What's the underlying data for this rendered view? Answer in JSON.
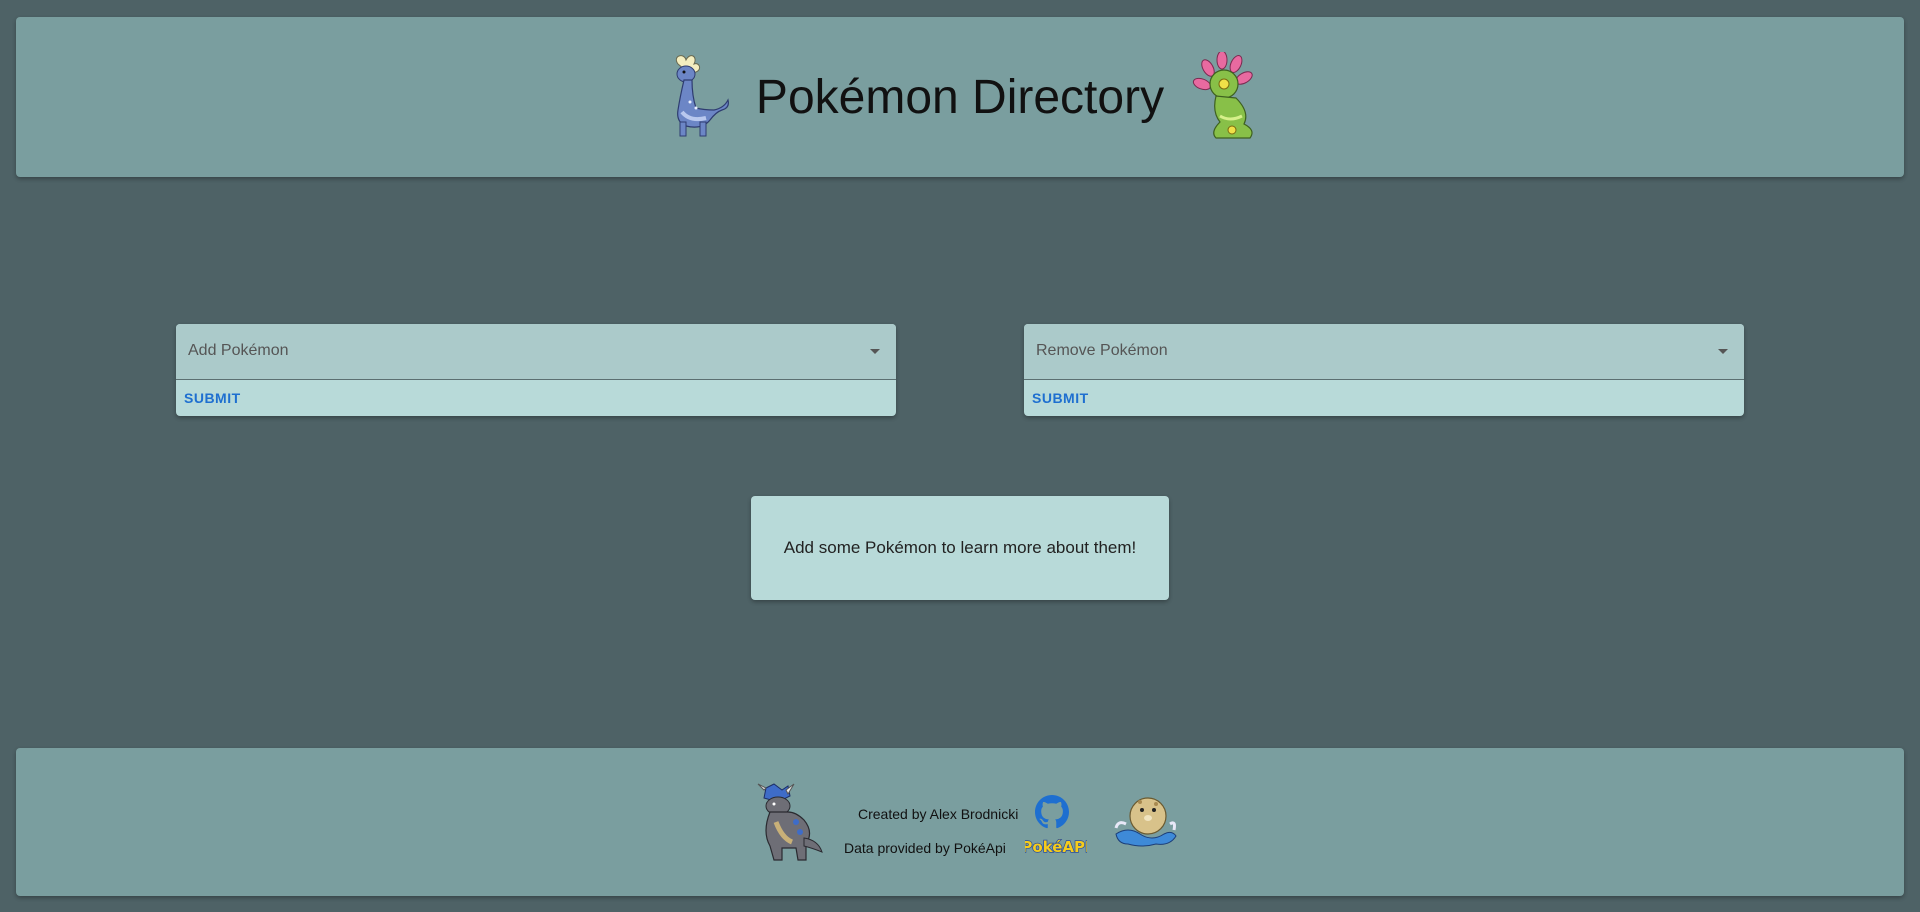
{
  "header": {
    "title": "Pokémon Directory",
    "left_sprite": "amaura-sprite",
    "right_sprite": "cradily-sprite"
  },
  "add_card": {
    "placeholder": "Add Pokémon",
    "submit_label": "SUBMIT"
  },
  "remove_card": {
    "placeholder": "Remove Pokémon",
    "submit_label": "SUBMIT"
  },
  "info": {
    "message": "Add some Pokémon to learn more about them!"
  },
  "footer": {
    "created_by": "Created by Alex Brodnicki",
    "data_provided": "Data provided by PokéApi",
    "github_icon": "github-icon",
    "pokeapi_logo": "pokeapi-logo",
    "left_sprite": "rampardos-sprite",
    "right_sprite": "spheal-sprite"
  },
  "colors": {
    "background": "#4e6266",
    "panel": "#7a9e9f",
    "card": "#b8dad9",
    "select": "#abcaca",
    "accent": "#1e6fd0"
  }
}
